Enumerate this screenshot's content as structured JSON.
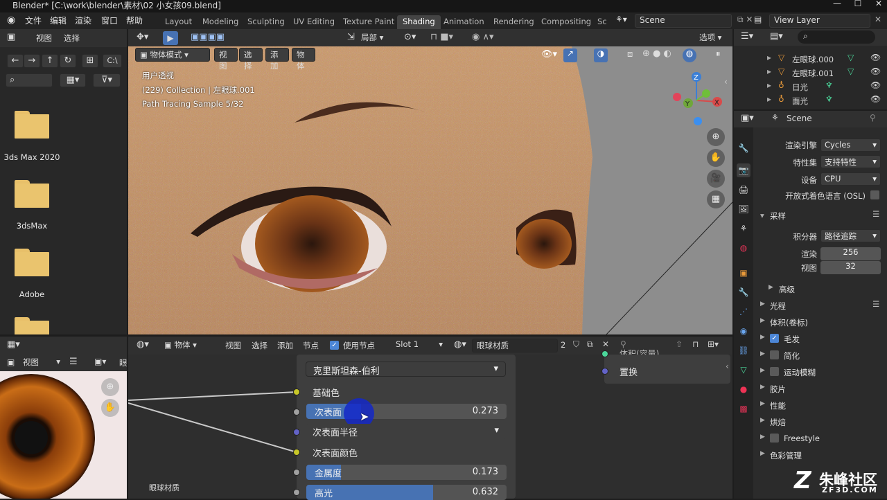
{
  "window": {
    "title": "Blender* [C:\\work\\blender\\素材\\02 小女孩09.blend]"
  },
  "menu": [
    "文件",
    "编辑",
    "渲染",
    "窗口",
    "帮助"
  ],
  "workspaces": [
    "Layout",
    "Modeling",
    "Sculpting",
    "UV Editing",
    "Texture Paint",
    "Shading",
    "Animation",
    "Rendering",
    "Compositing",
    "Sc"
  ],
  "active_workspace": "Shading",
  "scene": "Scene",
  "view_layer": "View Layer",
  "file_browser": {
    "menu": [
      "视图",
      "选择"
    ],
    "path": "C:\\",
    "folders": [
      "3ds Max 2020",
      "3dsMax",
      "Adobe"
    ]
  },
  "viewport": {
    "mode": "物体模式",
    "menu": [
      "视图",
      "选择",
      "添加",
      "物体"
    ],
    "transform": "局部",
    "options": "选项",
    "overlay_lines": [
      "用户透视",
      "(229) Collection | 左眼球.001",
      "Path Tracing Sample 5/32"
    ],
    "axes": [
      "Z",
      "Y",
      "X"
    ]
  },
  "outliner": {
    "items": [
      {
        "label": "左眼球.000"
      },
      {
        "label": "左眼球.001"
      },
      {
        "label": "日光"
      },
      {
        "label": "面光"
      }
    ]
  },
  "properties": {
    "header": "Scene",
    "render_engine_label": "渲染引擎",
    "render_engine": "Cycles",
    "feature_set_label": "特性集",
    "feature_set": "支持特性",
    "device_label": "设备",
    "device": "CPU",
    "osl_label": "开放式着色语言 (OSL)",
    "sampling_label": "采样",
    "integrator_label": "积分器",
    "integrator": "路径追踪",
    "render_label": "渲染",
    "render_samples": "256",
    "viewport_label": "视图",
    "viewport_samples": "32",
    "advanced_label": "高级",
    "panels": [
      {
        "label": "光程",
        "checkbox": false
      },
      {
        "label": "体积(卷标)",
        "checkbox": false
      },
      {
        "label": "毛发",
        "checkbox": true,
        "checked": true
      },
      {
        "label": "简化",
        "checkbox": true,
        "checked": false
      },
      {
        "label": "运动模糊",
        "checkbox": true,
        "checked": false
      },
      {
        "label": "胶片",
        "checkbox": false
      },
      {
        "label": "性能",
        "checkbox": false
      },
      {
        "label": "烘焙",
        "checkbox": false
      },
      {
        "label": "Freestyle",
        "checkbox": true,
        "checked": false
      },
      {
        "label": "色彩管理",
        "checkbox": false
      }
    ]
  },
  "image_editor": {
    "menu": "视图",
    "image_name": "眼球材质",
    "cut_label": "眼"
  },
  "node_editor": {
    "object_label": "物体",
    "menu": [
      "视图",
      "选择",
      "添加",
      "节点"
    ],
    "use_nodes_label": "使用节点",
    "slot": "Slot 1",
    "material": "眼球材质",
    "user_count": "2",
    "distribution": "克里斯坦森-伯利",
    "base_color": "基础色",
    "subsurface": {
      "label": "次表面",
      "value": "0.273",
      "fraction": 0.273
    },
    "subsurface_radius": "次表面半径",
    "subsurface_color": "次表面颜色",
    "metallic": {
      "label": "金属度",
      "value": "0.173",
      "fraction": 0.173
    },
    "specular": {
      "label": "高光",
      "value": "0.632",
      "fraction": 0.632
    },
    "output_popup": {
      "top_label": "体积(容量)",
      "displacement": "置换"
    }
  },
  "watermark": {
    "brand": "朱峰社区",
    "url": "ZF3D.COM"
  },
  "colors": {
    "accent": "#4772b3",
    "active_tab": "#444444",
    "folder": "#eac46e",
    "socket_yellow": "#c7c729",
    "socket_grey": "#a1a1a1",
    "socket_purple": "#6363c7"
  }
}
